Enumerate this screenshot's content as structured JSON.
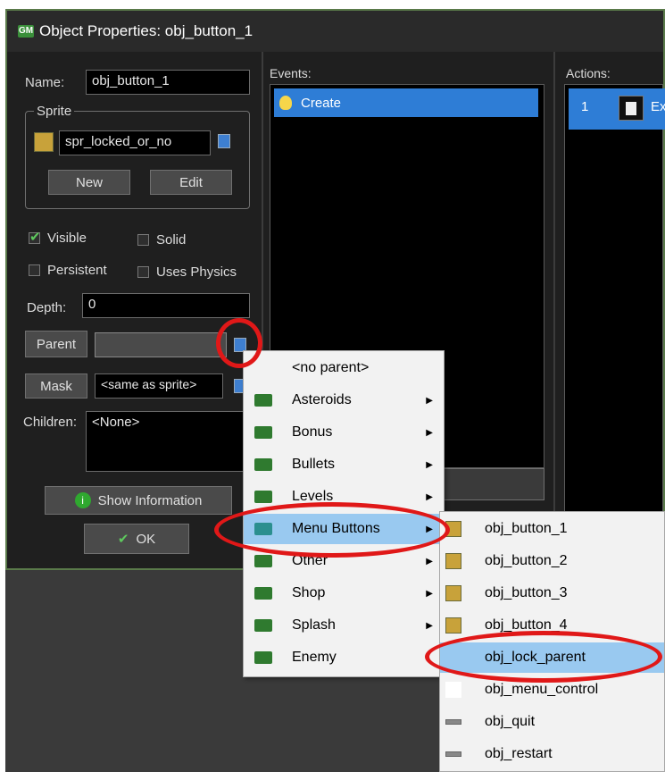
{
  "window": {
    "title": "Object Properties: obj_button_1"
  },
  "name": {
    "label": "Name:",
    "value": "obj_button_1"
  },
  "sprite": {
    "group_label": "Sprite",
    "value": "spr_locked_or_no",
    "new_label": "New",
    "edit_label": "Edit"
  },
  "checkboxes": {
    "visible": {
      "label": "Visible",
      "checked": true
    },
    "solid": {
      "label": "Solid",
      "checked": false
    },
    "persistent": {
      "label": "Persistent",
      "checked": false
    },
    "uses_physics": {
      "label": "Uses Physics",
      "checked": false
    }
  },
  "depth": {
    "label": "Depth:",
    "value": "0"
  },
  "parent": {
    "label": "Parent",
    "value": ""
  },
  "mask": {
    "label": "Mask",
    "value": "<same as sprite>"
  },
  "children": {
    "label": "Children:",
    "value": "<None>"
  },
  "show_info_label": "Show Information",
  "ok_label": "OK",
  "events": {
    "header": "Events:",
    "items": [
      "Create"
    ]
  },
  "actions": {
    "header": "Actions:",
    "items": [
      {
        "index": "1",
        "text": "Ex"
      }
    ]
  },
  "parent_menu": {
    "items": [
      {
        "label": "<no parent>",
        "folder": false,
        "submenu": false
      },
      {
        "label": "Asteroids",
        "folder": true,
        "submenu": true
      },
      {
        "label": "Bonus",
        "folder": true,
        "submenu": true
      },
      {
        "label": "Bullets",
        "folder": true,
        "submenu": true
      },
      {
        "label": "Levels",
        "folder": true,
        "submenu": true
      },
      {
        "label": "Menu Buttons",
        "folder": true,
        "submenu": true,
        "highlighted": true
      },
      {
        "label": "Other",
        "folder": true,
        "submenu": true
      },
      {
        "label": "Shop",
        "folder": true,
        "submenu": true
      },
      {
        "label": "Splash",
        "folder": true,
        "submenu": true
      },
      {
        "label": "Enemy",
        "folder": true,
        "submenu": false
      }
    ]
  },
  "sub_menu": {
    "items": [
      {
        "label": "obj_button_1",
        "icon": "sprite"
      },
      {
        "label": "obj_button_2",
        "icon": "sprite"
      },
      {
        "label": "obj_button_3",
        "icon": "sprite"
      },
      {
        "label": "obj_button_4",
        "icon": "sprite"
      },
      {
        "label": "obj_lock_parent",
        "icon": "none",
        "highlighted": true
      },
      {
        "label": "obj_menu_control",
        "icon": "blank"
      },
      {
        "label": "obj_quit",
        "icon": "bar"
      },
      {
        "label": "obj_restart",
        "icon": "bar"
      }
    ]
  },
  "colors": {
    "highlight": "#99c9f0",
    "selection": "#2e7dd6",
    "annotation": "#e01818"
  }
}
